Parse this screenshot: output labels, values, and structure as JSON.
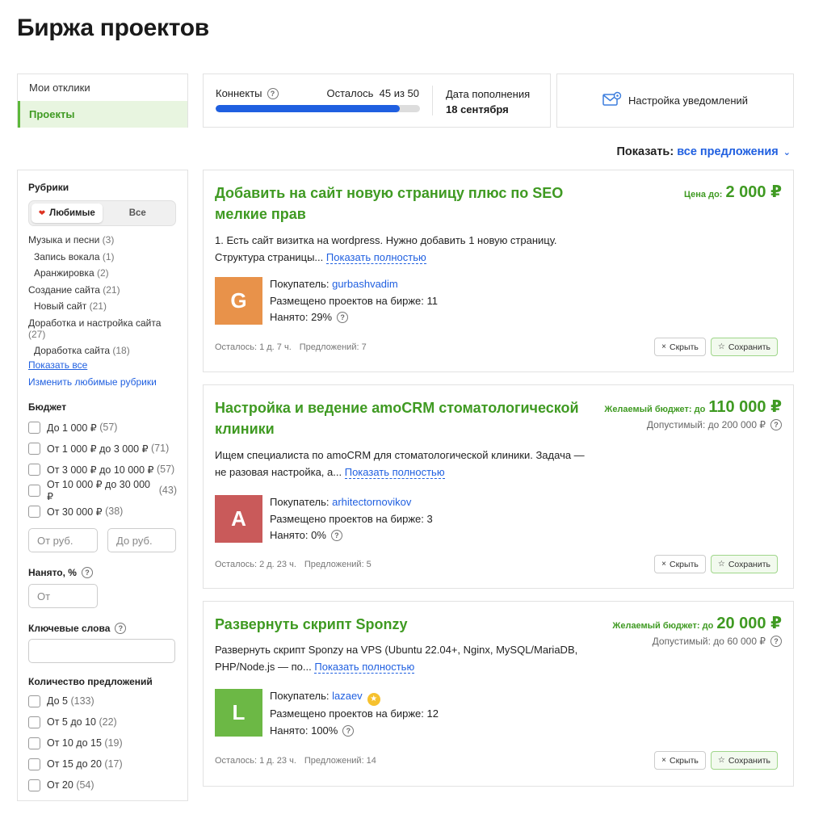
{
  "page_title": "Биржа проектов",
  "nav": {
    "items": [
      {
        "label": "Мои отклики"
      },
      {
        "label": "Проекты"
      }
    ]
  },
  "connects": {
    "label": "Коннекты",
    "remaining_text": "Осталось  45 из 50",
    "remaining": 45,
    "total": 50,
    "refill_label": "Дата пополнения",
    "refill_date": "18 сентября"
  },
  "notifications": {
    "label": "Настройка уведомлений",
    "icon": "envelope-gear-icon"
  },
  "show": {
    "label": "Показать:",
    "value": "все предложения"
  },
  "filters": {
    "rubrics_title": "Рубрики",
    "seg_fav": "Любимые",
    "seg_all": "Все",
    "rubrics": [
      {
        "name": "Музыка и песни",
        "count": "(3)",
        "sub": false
      },
      {
        "name": "Запись вокала",
        "count": "(1)",
        "sub": true
      },
      {
        "name": "Аранжировка",
        "count": "(2)",
        "sub": true
      },
      {
        "name": "Создание сайта",
        "count": "(21)",
        "sub": false
      },
      {
        "name": "Новый сайт",
        "count": "(21)",
        "sub": true
      },
      {
        "name": "Доработка и настройка сайта",
        "count": "(27)",
        "sub": false
      },
      {
        "name": "Доработка сайта",
        "count": "(18)",
        "sub": true
      }
    ],
    "show_all": "Показать все",
    "change_fav": "Изменить любимые рубрики",
    "budget_title": "Бюджет",
    "budget": [
      {
        "label": "До 1 000 ₽",
        "count": "(57)"
      },
      {
        "label": "От 1 000 ₽ до 3 000 ₽",
        "count": "(71)"
      },
      {
        "label": "От 3 000 ₽ до 10 000 ₽",
        "count": "(57)"
      },
      {
        "label": "От 10 000 ₽ до 30 000 ₽",
        "count": "(43)"
      },
      {
        "label": "От 30 000 ₽",
        "count": "(38)"
      }
    ],
    "from_placeholder": "От руб.",
    "to_placeholder": "До руб.",
    "hired_title": "Нанято, %",
    "hired_placeholder": "От",
    "keywords_title": "Ключевые слова",
    "offers_title": "Количество предложений",
    "offers": [
      {
        "label": "До 5",
        "count": "(133)"
      },
      {
        "label": "От 5 до 10",
        "count": "(22)"
      },
      {
        "label": "От 10 до 15",
        "count": "(19)"
      },
      {
        "label": "От 15 до 20",
        "count": "(17)"
      },
      {
        "label": "От 20",
        "count": "(54)"
      }
    ]
  },
  "projects": [
    {
      "title": "Добавить на сайт новую страницу плюс по SEO мелкие прав",
      "price_label": "Цена до:",
      "price": "2 000 ₽",
      "allowed": "",
      "desc": "1. Есть сайт визитка на wordpress. Нужно добавить 1 новую страницу. Структура страницы...",
      "more": "Показать полностью",
      "avatar_letter": "G",
      "avatar_color": "#e8924a",
      "buyer_label": "Покупатель:",
      "buyer": "gurbashvadim",
      "placed": "Размещено проектов на бирже: 11",
      "hired": "Нанято: 29%",
      "left": "Осталось: 1 д. 7 ч.",
      "offers": "Предложений: 7",
      "hide": "Скрыть",
      "save": "Сохранить"
    },
    {
      "title": "Настройка и ведение amoCRM стоматологической клиники",
      "price_label": "Желаемый бюджет: до",
      "price": "110 000 ₽",
      "allowed": "Допустимый: до 200 000 ₽",
      "desc": "Ищем специалиста по amoCRM для стоматологической клиники. Задача — не разовая настройка, а...",
      "more": "Показать полностью",
      "avatar_letter": "A",
      "avatar_color": "#c95a5a",
      "buyer_label": "Покупатель:",
      "buyer": "arhitectornovikov",
      "placed": "Размещено проектов на бирже: 3",
      "hired": "Нанято: 0%",
      "left": "Осталось: 2 д. 23 ч.",
      "offers": "Предложений: 5",
      "hide": "Скрыть",
      "save": "Сохранить"
    },
    {
      "title": "Развернуть скрипт Sponzy",
      "price_label": "Желаемый бюджет: до",
      "price": "20 000 ₽",
      "allowed": "Допустимый: до 60 000 ₽",
      "desc": "Развернуть скрипт Sponzy на VPS (Ubuntu 22.04+, Nginx, MySQL/MariaDB, PHP/Node.js — по...",
      "more": "Показать полностью",
      "avatar_letter": "L",
      "avatar_color": "#6cb845",
      "buyer_label": "Покупатель:",
      "buyer": "lazaev",
      "placed": "Размещено проектов на бирже: 12",
      "hired": "Нанято: 100%",
      "left": "Осталось: 1 д. 23 ч.",
      "offers": "Предложений: 14",
      "hide": "Скрыть",
      "save": "Сохранить"
    }
  ]
}
